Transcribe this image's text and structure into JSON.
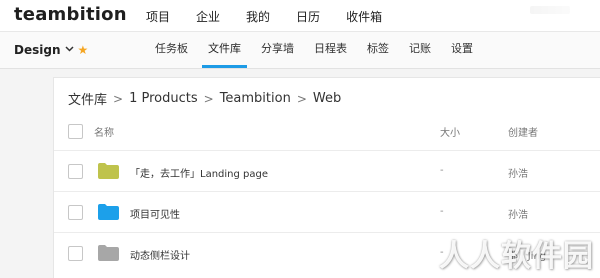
{
  "app": {
    "logo": "teambition"
  },
  "top_nav": [
    "项目",
    "企业",
    "我的",
    "日历",
    "收件箱"
  ],
  "project": {
    "name": "Design",
    "chevron": "chevron-down-icon",
    "star": "star-icon",
    "star_color": "#f5a623"
  },
  "tabs": [
    {
      "label": "任务板",
      "active": false
    },
    {
      "label": "文件库",
      "active": true
    },
    {
      "label": "分享墙",
      "active": false
    },
    {
      "label": "日程表",
      "active": false
    },
    {
      "label": "标签",
      "active": false
    },
    {
      "label": "记账",
      "active": false
    },
    {
      "label": "设置",
      "active": false
    }
  ],
  "accent": "#1d9be6",
  "breadcrumb": [
    "文件库",
    "1 Products",
    "Teambition",
    "Web"
  ],
  "breadcrumb_separator": ">",
  "columns": {
    "name": "名称",
    "size": "大小",
    "creator": "创建者"
  },
  "files": [
    {
      "name": "「走，去工作」Landing page",
      "size": "-",
      "creator": "孙浩",
      "icon": "folder-icon",
      "color": "#bfc34c"
    },
    {
      "name": "项目可见性",
      "size": "-",
      "creator": "孙浩",
      "icon": "folder-icon",
      "color": "#1ca0ea"
    },
    {
      "name": "动态侧栏设计",
      "size": "-",
      "creator": "邵 | Jing",
      "icon": "folder-icon",
      "color": "#a7a7a7"
    }
  ],
  "watermark": "人人软件园"
}
